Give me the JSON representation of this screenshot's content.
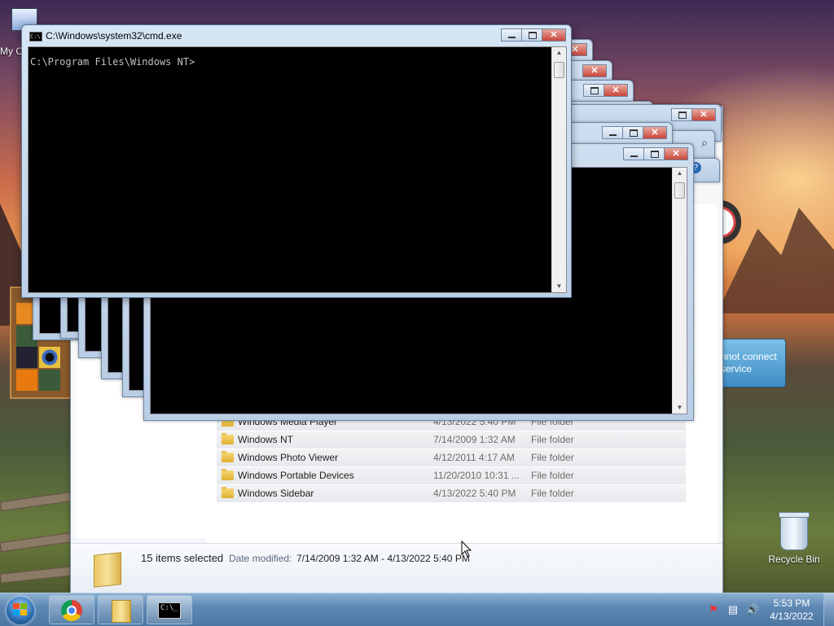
{
  "desktop": {
    "icons": {
      "my_computer": "My C",
      "recycle_bin": "Recycle Bin"
    },
    "notification_lines": [
      "nnot connect",
      "service"
    ]
  },
  "cmd": {
    "title": "C:\\Windows\\system32\\cmd.exe",
    "prompt": "C:\\Program Files\\Windows NT>",
    "icon_text": "C:\\"
  },
  "explorer": {
    "files": [
      {
        "name": "Windows Media Player",
        "date": "4/13/2022 5:40 PM",
        "type": "File folder"
      },
      {
        "name": "Windows NT",
        "date": "7/14/2009 1:32 AM",
        "type": "File folder"
      },
      {
        "name": "Windows Photo Viewer",
        "date": "4/12/2011 4:17 AM",
        "type": "File folder"
      },
      {
        "name": "Windows Portable Devices",
        "date": "11/20/2010 10:31 ...",
        "type": "File folder"
      },
      {
        "name": "Windows Sidebar",
        "date": "4/13/2022 5:40 PM",
        "type": "File folder"
      }
    ],
    "details": {
      "selection": "15 items selected",
      "date_label": "Date modified:",
      "date_value": "7/14/2009 1:32 AM - 4/13/2022 5:40 PM"
    }
  },
  "taskbar": {
    "clock_time": "5:53 PM",
    "clock_date": "4/13/2022",
    "cmd_button_text": "C:\\_"
  },
  "colors": {
    "console_bg": "#000000",
    "console_text": "#c0c0c0",
    "close_button": "#c9463a",
    "taskbar": "#4d76a2"
  }
}
